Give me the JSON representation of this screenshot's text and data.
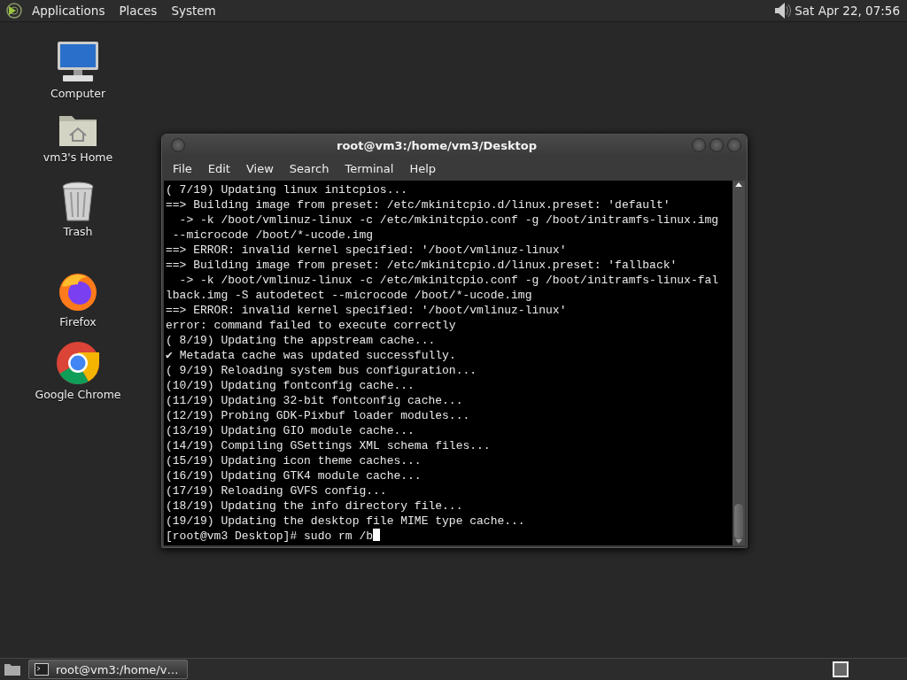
{
  "top_panel": {
    "menus": [
      "Applications",
      "Places",
      "System"
    ],
    "clock": "Sat Apr 22, 07:56"
  },
  "desktop_icons": [
    {
      "label": "Computer",
      "kind": "computer"
    },
    {
      "label": "vm3's Home",
      "kind": "home"
    },
    {
      "label": "Trash",
      "kind": "trash"
    },
    {
      "label": "Firefox",
      "kind": "firefox"
    },
    {
      "label": "Google Chrome",
      "kind": "chrome"
    }
  ],
  "terminal": {
    "title": "root@vm3:/home/vm3/Desktop",
    "menu": [
      "File",
      "Edit",
      "View",
      "Search",
      "Terminal",
      "Help"
    ],
    "lines": [
      "( 7/19) Updating linux initcpios...",
      "==> Building image from preset: /etc/mkinitcpio.d/linux.preset: 'default'",
      "  -> -k /boot/vmlinuz-linux -c /etc/mkinitcpio.conf -g /boot/initramfs-linux.img",
      " --microcode /boot/*-ucode.img",
      "==> ERROR: invalid kernel specified: '/boot/vmlinuz-linux'",
      "==> Building image from preset: /etc/mkinitcpio.d/linux.preset: 'fallback'",
      "  -> -k /boot/vmlinuz-linux -c /etc/mkinitcpio.conf -g /boot/initramfs-linux-fal",
      "lback.img -S autodetect --microcode /boot/*-ucode.img",
      "==> ERROR: invalid kernel specified: '/boot/vmlinuz-linux'",
      "error: command failed to execute correctly",
      "( 8/19) Updating the appstream cache...",
      "✔ Metadata cache was updated successfully.",
      "( 9/19) Reloading system bus configuration...",
      "(10/19) Updating fontconfig cache...",
      "(11/19) Updating 32-bit fontconfig cache...",
      "(12/19) Probing GDK-Pixbuf loader modules...",
      "(13/19) Updating GIO module cache...",
      "(14/19) Compiling GSettings XML schema files...",
      "(15/19) Updating icon theme caches...",
      "(16/19) Updating GTK4 module cache...",
      "(17/19) Reloading GVFS config...",
      "(18/19) Updating the info directory file...",
      "(19/19) Updating the desktop file MIME type cache..."
    ],
    "prompt": "[root@vm3 Desktop]# sudo rm /b"
  },
  "taskbar": {
    "tasks": [
      {
        "label": "root@vm3:/home/v…",
        "selected": true
      }
    ]
  }
}
